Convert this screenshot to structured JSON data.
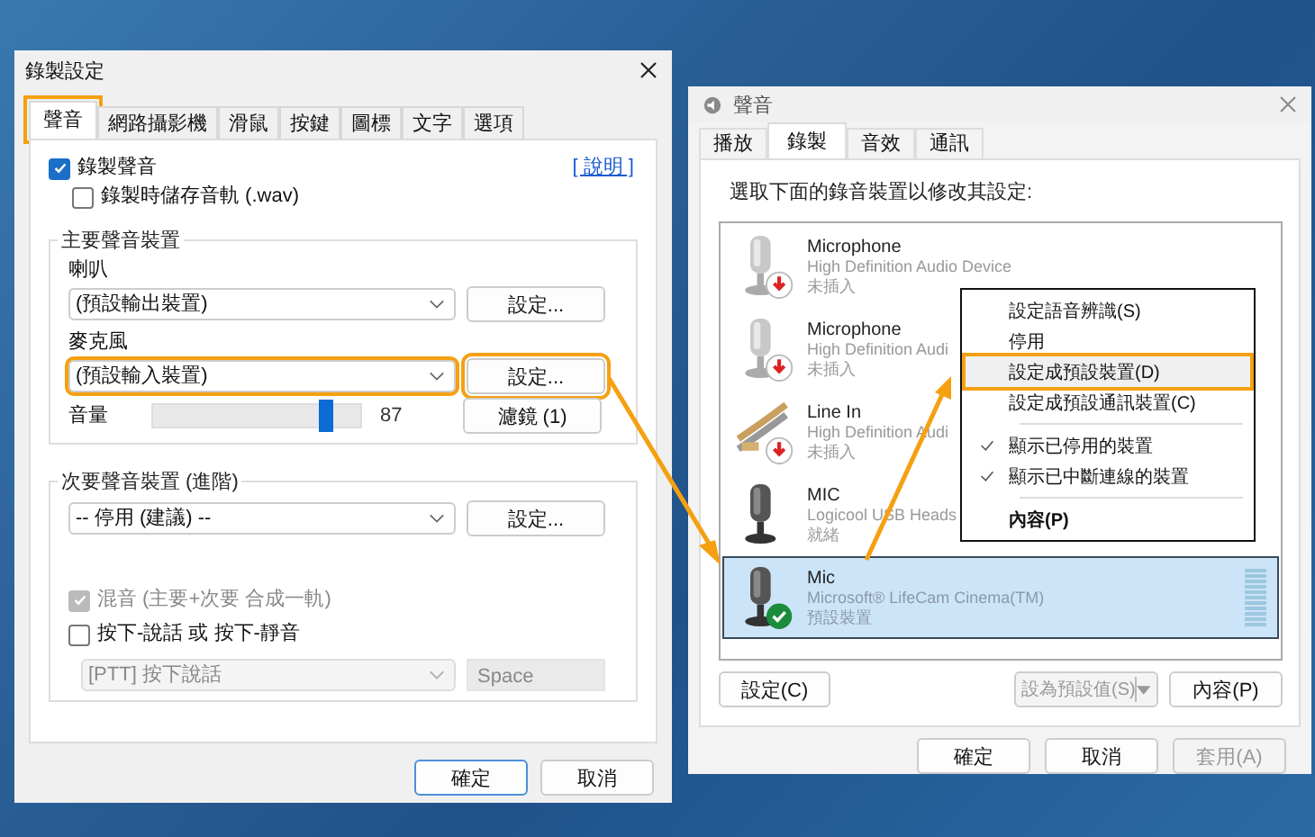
{
  "recording_settings": {
    "title": "錄製設定",
    "tabs": [
      {
        "label": "聲音",
        "selected": true,
        "highlight": true
      },
      {
        "label": "網路攝影機",
        "selected": false,
        "highlight": false
      },
      {
        "label": "滑鼠",
        "selected": false,
        "highlight": false
      },
      {
        "label": "按鍵",
        "selected": false,
        "highlight": false
      },
      {
        "label": "圖標",
        "selected": false,
        "highlight": false
      },
      {
        "label": "文字",
        "selected": false,
        "highlight": false
      },
      {
        "label": "選項",
        "selected": false,
        "highlight": false
      }
    ],
    "record_audio": {
      "label": "錄製聲音",
      "checked": true
    },
    "help_link": "[ 說明 ]",
    "save_wav": {
      "label": "錄製時儲存音軌 (.wav)",
      "checked": false
    },
    "primary": {
      "legend": "主要聲音裝置",
      "speaker": {
        "label": "喇叭",
        "value": "(預設輸出裝置)",
        "button": "設定...",
        "highlight": false
      },
      "microphone": {
        "label": "麥克風",
        "value": "(預設輸入裝置)",
        "button": "設定...",
        "highlight": true
      },
      "volume": {
        "label": "音量",
        "level": 0.87,
        "reading": "87"
      },
      "filter_button": "濾鏡 (1)"
    },
    "secondary": {
      "legend": "次要聲音裝置 (進階)",
      "value": "-- 停用 (建議) --",
      "button": "設定...",
      "mix": {
        "label": "混音 (主要+次要 合成一軌)",
        "checked": true,
        "disabled": true
      },
      "push_to_talk": {
        "label": "按下-說話 或 按下-靜音",
        "checked": false,
        "disabled": false
      },
      "ptt_mode": "[PTT] 按下說話",
      "ptt_key": "Space"
    },
    "buttons": [
      {
        "label": "確定",
        "primary": true
      },
      {
        "label": "取消",
        "primary": false
      }
    ]
  },
  "sound": {
    "title": "聲音",
    "tabs": [
      {
        "label": "播放",
        "selected": false
      },
      {
        "label": "錄製",
        "selected": true
      },
      {
        "label": "音效",
        "selected": false
      },
      {
        "label": "通訊",
        "selected": false
      }
    ],
    "instruction": "選取下面的錄音裝置以修改其設定:",
    "devices": [
      {
        "kind": "mic",
        "name": "Microphone",
        "description": "High Definition Audio Device",
        "status": "未插入",
        "unplugged": true,
        "is_default": false,
        "selected": false
      },
      {
        "kind": "mic",
        "name": "Microphone",
        "description": "High Definition Audi",
        "status": "未插入",
        "unplugged": true,
        "is_default": false,
        "selected": false
      },
      {
        "kind": "line",
        "name": "Line In",
        "description": "High Definition Audi",
        "status": "未插入",
        "unplugged": true,
        "is_default": false,
        "selected": false
      },
      {
        "kind": "mic",
        "name": "MIC",
        "description": "Logicool USB Heads",
        "status": "就緒",
        "unplugged": false,
        "is_default": false,
        "selected": false
      },
      {
        "kind": "mic",
        "name": "Mic",
        "description": "Microsoft® LifeCam Cinema(TM)",
        "status": "預設裝置",
        "unplugged": false,
        "is_default": true,
        "selected": true
      }
    ],
    "menu": [
      [
        {
          "label": "設定語音辨識(S)",
          "checked": false,
          "selected": false,
          "highlight": false,
          "bold": false
        },
        {
          "label": "停用",
          "checked": false,
          "selected": false,
          "highlight": false,
          "bold": false
        },
        {
          "label": "設定成預設裝置(D)",
          "checked": false,
          "selected": true,
          "highlight": true,
          "bold": false
        },
        {
          "label": "設定成預設通訊裝置(C)",
          "checked": false,
          "selected": false,
          "highlight": false,
          "bold": false
        }
      ],
      [
        {
          "label": "顯示已停用的裝置",
          "checked": true,
          "selected": false,
          "highlight": false,
          "bold": false
        },
        {
          "label": "顯示已中斷連線的裝置",
          "checked": true,
          "selected": false,
          "highlight": false,
          "bold": false
        }
      ],
      [
        {
          "label": "內容(P)",
          "checked": false,
          "selected": false,
          "highlight": false,
          "bold": true
        }
      ]
    ],
    "configure_button": "設定(C)",
    "set_default_button": {
      "label": "設為預設值(S)",
      "disabled": true
    },
    "properties_button": "內容(P)",
    "buttons": [
      {
        "label": "確定",
        "disabled": false
      },
      {
        "label": "取消",
        "disabled": false
      },
      {
        "label": "套用(A)",
        "disabled": true
      }
    ]
  }
}
